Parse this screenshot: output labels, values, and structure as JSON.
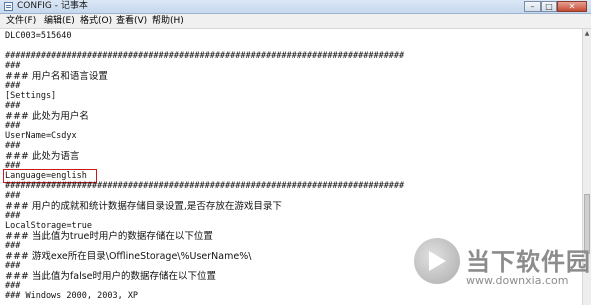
{
  "window": {
    "title": "CONFIG - 记事本",
    "minimize": "–",
    "maximize": "□",
    "close": "✕"
  },
  "menu": [
    "文件(F)",
    "编辑(E)",
    "格式(O)",
    "查看(V)",
    "帮助(H)"
  ],
  "editor": {
    "lines": [
      "DLC003=515640",
      "",
      "##############################################################################",
      "###",
      "### 用户名和语言设置",
      "###",
      "[Settings]",
      "###",
      "### 此处为用户名",
      "###",
      "UserName=Csdyx",
      "###",
      "### 此处为语言",
      "###",
      "Language=english",
      "##############################################################################",
      "###",
      "### 用户的成就和统计数据存储目录设置,是否存放在游戏目录下",
      "###",
      "LocalStorage=true",
      "### 当此值为true时用户的数据存储在以下位置",
      "###",
      "### 游戏exe所在目录\\OfflineStorage\\%UserName%\\",
      "###",
      "### 当此值为false时用户的数据存储在以下位置",
      "###",
      "### Windows 2000, 2003, XP"
    ]
  },
  "watermark": {
    "name": "当下软件园",
    "url": "www.downxia.com"
  }
}
